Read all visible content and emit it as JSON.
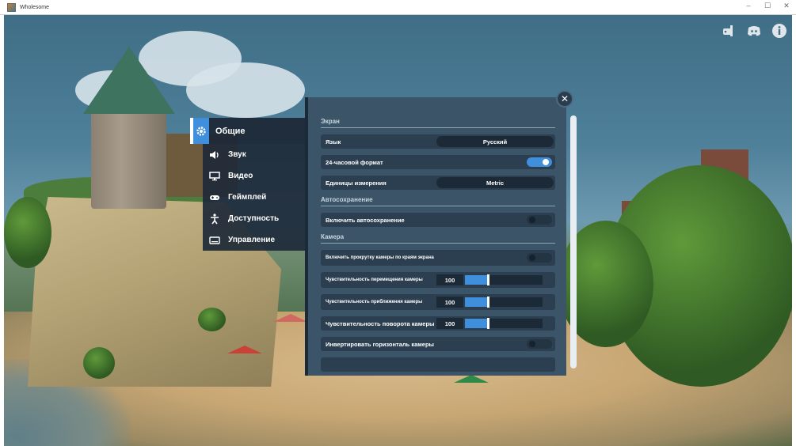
{
  "window": {
    "title": "Wholesome"
  },
  "top_icons": [
    {
      "name": "game-controller-icon"
    },
    {
      "name": "discord-icon"
    },
    {
      "name": "info-icon"
    }
  ],
  "tabs": [
    {
      "label": "Общие",
      "icon": "gear-icon"
    },
    {
      "label": "Звук",
      "icon": "speaker-icon"
    },
    {
      "label": "Видео",
      "icon": "monitor-icon"
    },
    {
      "label": "Геймплей",
      "icon": "gamepad-icon"
    },
    {
      "label": "Доступность",
      "icon": "accessibility-icon"
    },
    {
      "label": "Управление",
      "icon": "keyboard-icon"
    }
  ],
  "settings": {
    "screen_section": "Экран",
    "language_label": "Язык",
    "language_value": "Русский",
    "clock_label": "24-часовой формат",
    "clock_on": true,
    "units_label": "Единицы измерения",
    "units_value": "Metric",
    "autosave_section": "Автосохранение",
    "autosave_label": "Включить автосохранение",
    "autosave_on": false,
    "camera_section": "Камера",
    "edge_scroll_label": "Включить прокрутку камеры по краям экрана",
    "edge_scroll_on": false,
    "pan_label": "Чувствительность перемещения камеры",
    "pan_value": "100",
    "pan_fraction": 0.3,
    "zoom_label": "Чувствительность приближения камеры",
    "zoom_value": "100",
    "zoom_fraction": 0.3,
    "rotate_label": "Чувствительность поворота камеры",
    "rotate_value": "100",
    "rotate_fraction": 0.3,
    "invert_h_label": "Инвертировать горизонталь камеры",
    "invert_h_on": false
  },
  "colors": {
    "accent": "#3f8fdc",
    "panel": "#3b5468",
    "row": "#2b3f51"
  }
}
